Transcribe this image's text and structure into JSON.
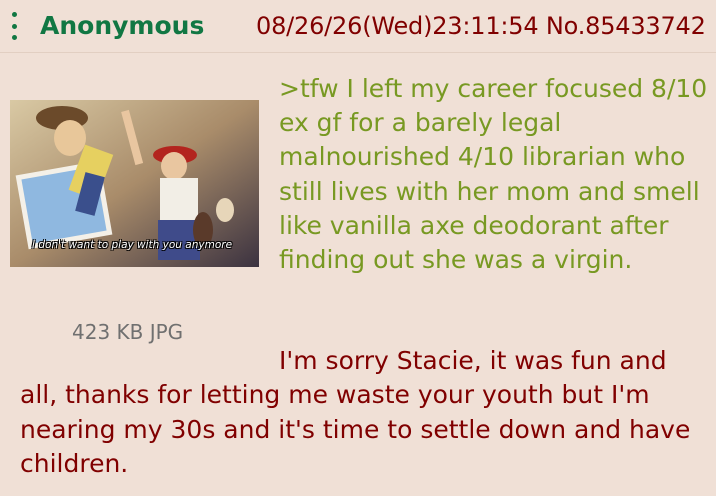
{
  "post": {
    "author": "Anonymous",
    "datetime": "08/26/26(Wed)23:11:54",
    "number": "No.85433742",
    "image": {
      "caption": "I don't want to play with you anymore",
      "file_info": "423 KB JPG"
    },
    "greentext": ">tfw I left my career focused 8/10 ex gf for a barely legal malnourished 4/10 librarian who still lives with her mom and smell like vanilla axe deodorant after finding out she was a virgin.",
    "body_first_line": "I'm sorry Stacie, it was fun and",
    "body_rest": "all, thanks for letting me waste your youth but I'm nearing my 30s and it's time to settle down and have children."
  },
  "icons": {
    "menu": "vertical-dots-icon"
  },
  "colors": {
    "background": "#f0e0d6",
    "name": "#117743",
    "meta": "#800000",
    "greentext": "#789922",
    "body": "#800000"
  }
}
